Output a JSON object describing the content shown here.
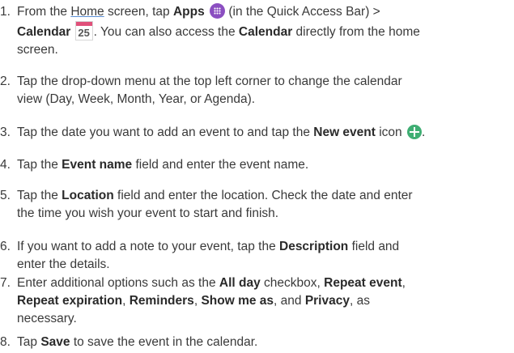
{
  "steps": [
    {
      "num": "1.",
      "l1_a": "From the ",
      "l1_home": "Home",
      "l1_b": " screen, tap ",
      "l1_apps": "Apps",
      "l1_c": " (in the Quick Access Bar) >",
      "l2_cal": "Calendar",
      "calendar_icon_date": "25",
      "l2_b": ". You can also access the ",
      "l2_cal2": "Calendar",
      "l2_c": " directly from the home",
      "l3": "screen."
    },
    {
      "num": "2.",
      "l1": "Tap the drop-down menu at the top left corner to change the calendar",
      "l2": "view (Day, Week, Month, Year, or Agenda)."
    },
    {
      "num": "3.",
      "l1_a": "Tap the date you want to add an event to and tap the ",
      "l1_b": "New event",
      "l1_c": " icon"
    },
    {
      "num": "4.",
      "l1_a": "Tap the ",
      "l1_b": "Event name",
      "l1_c": " field and enter the event name."
    },
    {
      "num": "5.",
      "l1_a": "Tap the ",
      "l1_b": "Location",
      "l1_c": " field and enter the location. Check the date and enter",
      "l2": "the time you wish your event to start and finish."
    },
    {
      "num": "6.",
      "l1_a": "If you want to add a note to your event, tap the ",
      "l1_b": "Description",
      "l1_c": " field and",
      "l2": "enter the details."
    },
    {
      "num": "7.",
      "l1_a": "Enter additional options such as the ",
      "l1_b": "All day",
      "l1_c": " checkbox, ",
      "l1_d": "Repeat event",
      "l1_e": ",",
      "l2_a": "Repeat expiration",
      "l2_b": ", ",
      "l2_c": "Reminders",
      "l2_d": ", ",
      "l2_e": "Show me as",
      "l2_f": ", and ",
      "l2_g": "Privacy",
      "l2_h": ", as",
      "l3": "necessary."
    },
    {
      "num": "8.",
      "l1_a": "Tap ",
      "l1_b": "Save",
      "l1_c": " to save the event in the calendar."
    }
  ],
  "icons": {
    "apps": "apps-icon",
    "calendar": "calendar-icon",
    "new_event": "plus-circle-icon"
  },
  "colors": {
    "apps_icon": "#8b4fc1",
    "calendar_header": "#e0507a",
    "new_event_icon": "#3fae73",
    "text": "#3a3a3a"
  }
}
